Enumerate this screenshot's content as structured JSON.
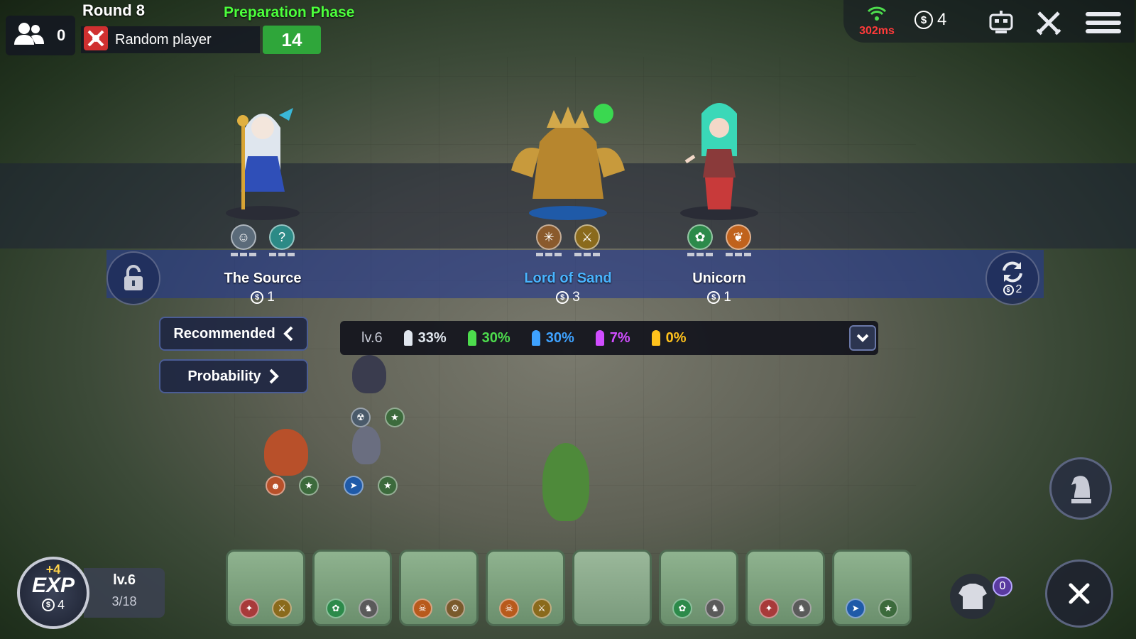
{
  "hud": {
    "round": "Round 8",
    "phase": "Preparation Phase",
    "players_count": "0",
    "opponent_name": "Random player",
    "timer": "14",
    "ping": "302ms",
    "gold": "4"
  },
  "shop": {
    "refresh_cost": "2",
    "cards": [
      {
        "name": "The Source",
        "cost": "1",
        "name_color": "#e8f2ff",
        "traits": [
          "human-icon",
          "mage-icon"
        ],
        "trait_colors": [
          "#5b6b7a",
          "#2c8a86"
        ]
      },
      {
        "name": "Lord of Sand",
        "cost": "3",
        "name_color": "#49b4ff",
        "traits": [
          "spider-icon",
          "warrior-icon"
        ],
        "trait_colors": [
          "#8a5a2c",
          "#8a6a1c"
        ]
      },
      {
        "name": "Unicorn",
        "cost": "1",
        "name_color": "#e8f2ff",
        "traits": [
          "beast-icon",
          "druid-icon"
        ],
        "trait_colors": [
          "#2c8a4a",
          "#c0621c"
        ]
      }
    ],
    "recommended_label": "Recommended",
    "probability_label": "Probability"
  },
  "odds": {
    "level": "lv.6",
    "tiers": [
      {
        "value": "33%",
        "color": "#e0e6ee"
      },
      {
        "value": "30%",
        "color": "#4ddc4d"
      },
      {
        "value": "30%",
        "color": "#3ea2ff"
      },
      {
        "value": "7%",
        "color": "#d04dff"
      },
      {
        "value": "0%",
        "color": "#ffc21c"
      }
    ]
  },
  "exp": {
    "gain": "+4",
    "label": "EXP",
    "cost": "4",
    "level": "lv.6",
    "progress": "3/18"
  },
  "armor_count": "0",
  "colors": {
    "phase": "#4cff3c",
    "timer_bg": "#2fa63a",
    "ping": "#ff3a3a",
    "shop_band": "#263a8c"
  }
}
